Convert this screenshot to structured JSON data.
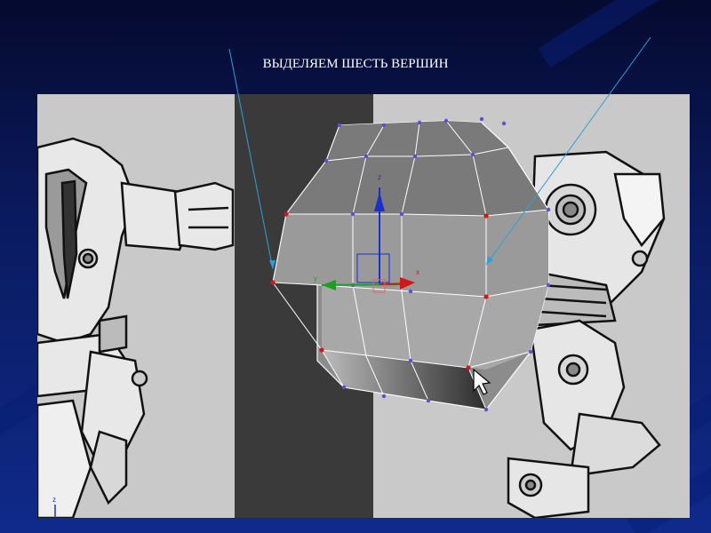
{
  "slide": {
    "title": "ВЫДЕЛЯЕМ ШЕСТЬ ВЕРШИН"
  },
  "viewport": {
    "background_color": "#c9c9c9",
    "wall_color": "#3c3c3c",
    "gizmo_labels": {
      "z": "z",
      "x": "x",
      "y": "y",
      "axis_z": "z"
    }
  },
  "colors": {
    "selected_vertex": "#d01818",
    "vertex": "#5a4fd8",
    "annotation_line": "#2ea0d8",
    "gizmo_z": "#1a2fd0",
    "gizmo_x": "#d01818",
    "gizmo_y": "#1aa020"
  },
  "icons": [
    "cursor-arrow-icon",
    "transform-gizmo-icon"
  ]
}
